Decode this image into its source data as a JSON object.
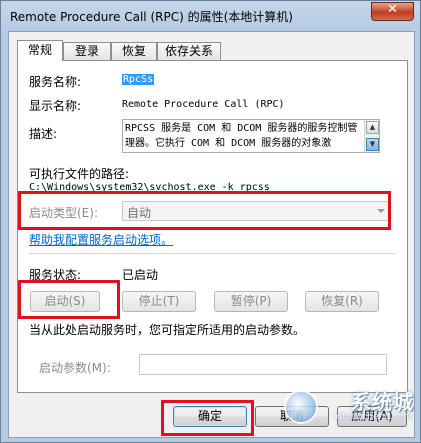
{
  "window": {
    "title": "Remote Procedure Call (RPC) 的属性(本地计算机)",
    "close_label": "✕"
  },
  "tabs": [
    {
      "label": "常规"
    },
    {
      "label": "登录"
    },
    {
      "label": "恢复"
    },
    {
      "label": "依存关系"
    }
  ],
  "general": {
    "service_name_label": "服务名称:",
    "service_name_value": "RpcSs",
    "display_name_label": "显示名称:",
    "display_name_value": "Remote Procedure Call (RPC)",
    "description_label": "描述:",
    "description_value": "RPCSS 服务是 COM 和 DCOM 服务器的服务控制管理器。它执行 COM 和 DCOM 服务器的对象激",
    "exe_path_label": "可执行文件的路径:",
    "exe_path_value": "C:\\Windows\\system32\\svchost.exe -k rpcss",
    "startup_type_label": "启动类型(E):",
    "startup_type_value": "自动",
    "help_link": "帮助我配置服务启动选项。",
    "status_label": "服务状态:",
    "status_value": "已启动",
    "start_button": "启动(S)",
    "stop_button": "停止(T)",
    "pause_button": "暂停(P)",
    "resume_button": "恢复(R)",
    "hint_text": "当从此处启动服务时，您可指定所适用的启动参数。",
    "start_params_label": "启动参数(M):",
    "start_params_value": ""
  },
  "footer": {
    "ok_button": "确定",
    "cancel_button": "取消",
    "apply_button": "应用(A)"
  },
  "watermark": {
    "text": "系统城",
    "sub": "xitongcheng.com"
  },
  "colors": {
    "highlight_box": "#e01020",
    "link": "#0066cc",
    "selection": "#3399ff"
  }
}
